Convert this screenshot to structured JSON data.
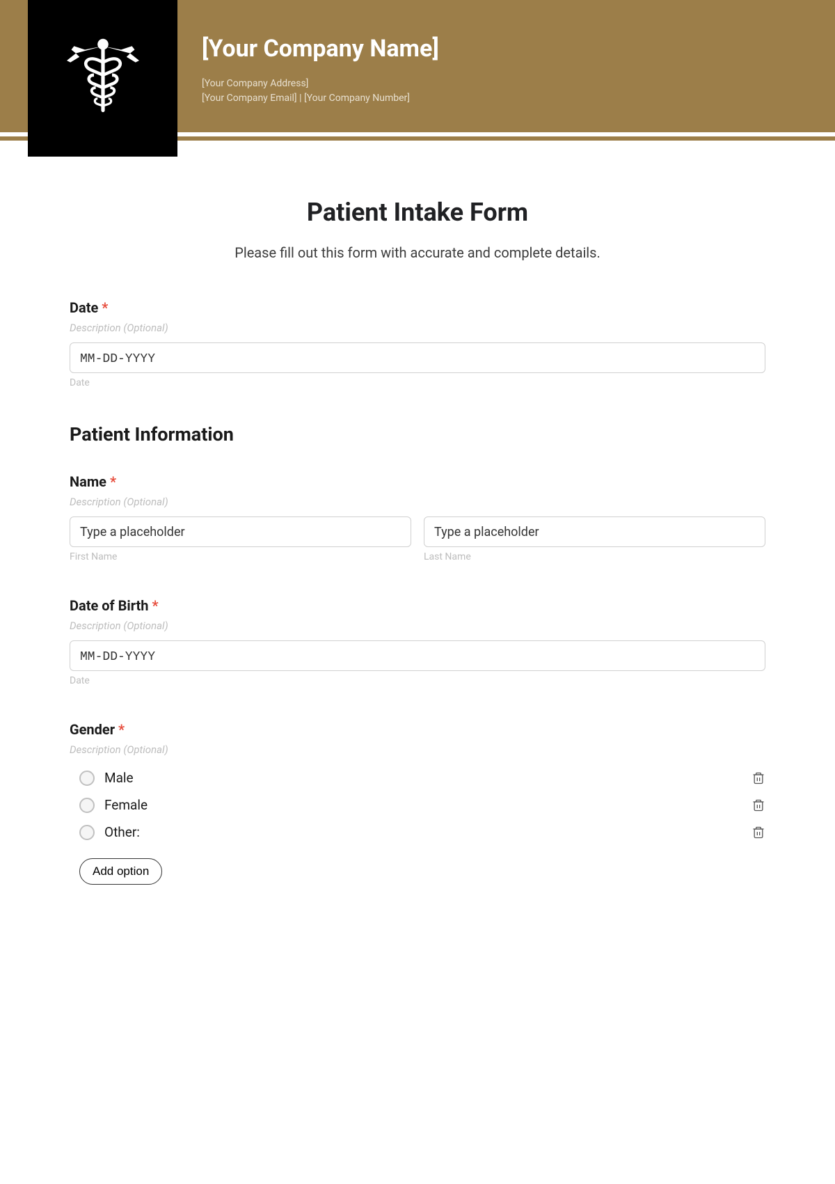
{
  "header": {
    "company_name": "[Your Company Name]",
    "company_address": "[Your Company Address]",
    "company_contact": "[Your Company Email]  |  [Your Company Number]"
  },
  "form": {
    "title": "Patient Intake Form",
    "subtitle": "Please fill out this form with accurate and complete details.",
    "desc_placeholder": "Description (Optional)",
    "date_sublabel": "Date",
    "date_placeholder": "MM-DD-YYYY",
    "name_placeholder": "Type a placeholder",
    "fields": {
      "date_label": "Date",
      "name_label": "Name",
      "first_name_sub": "First Name",
      "last_name_sub": "Last Name",
      "dob_label": "Date of Birth",
      "gender_label": "Gender"
    },
    "section_patient_info": "Patient Information",
    "gender_options": [
      "Male",
      "Female",
      "Other:"
    ],
    "add_option_label": "Add option",
    "required_mark": "*"
  }
}
